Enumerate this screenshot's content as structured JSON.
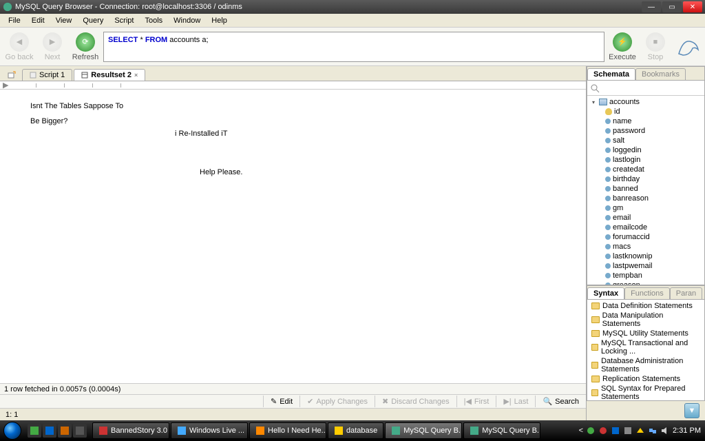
{
  "window": {
    "title": "MySQL Query Browser - Connection: root@localhost:3306 / odinms"
  },
  "menu": {
    "file": "File",
    "edit": "Edit",
    "view": "View",
    "query": "Query",
    "script": "Script",
    "tools": "Tools",
    "window": "Window",
    "help": "Help"
  },
  "toolbar": {
    "goback": "Go back",
    "next": "Next",
    "refresh": "Refresh",
    "execute": "Execute",
    "stop": "Stop"
  },
  "query": {
    "kw1": "SELECT",
    "star": " * ",
    "kw2": "FROM",
    "rest": " accounts a;"
  },
  "tabs": {
    "script1": "Script 1",
    "resultset2": "Resultset 2"
  },
  "overlay": {
    "l1": "Isnt The Tables Sappose To",
    "l2": "Be Bigger?",
    "l3": "i Re-Installed iT",
    "l4": "Help Please."
  },
  "status": {
    "fetched": "1 row fetched in 0.0057s (0.0004s)",
    "pos": "1:   1"
  },
  "editbar": {
    "edit": "Edit",
    "apply": "Apply Changes",
    "discard": "Discard Changes",
    "first": "First",
    "last": "Last",
    "search": "Search"
  },
  "schemapanel": {
    "tab_schemata": "Schemata",
    "tab_bookmarks": "Bookmarks",
    "table": "accounts",
    "cols": [
      "id",
      "name",
      "password",
      "salt",
      "loggedin",
      "lastlogin",
      "createdat",
      "birthday",
      "banned",
      "banreason",
      "gm",
      "email",
      "emailcode",
      "forumaccid",
      "macs",
      "lastknownip",
      "lastpwemail",
      "tempban",
      "greason"
    ]
  },
  "syntaxpanel": {
    "tab_syntax": "Syntax",
    "tab_functions": "Functions",
    "tab_params": "Paran",
    "items": [
      "Data Definition Statements",
      "Data Manipulation Statements",
      "MySQL Utility Statements",
      "MySQL Transactional and Locking ...",
      "Database Administration Statements",
      "Replication Statements",
      "SQL Syntax for Prepared Statements"
    ]
  },
  "taskbar": {
    "tasks": [
      {
        "label": "BannedStory 3.0"
      },
      {
        "label": "Windows Live ..."
      },
      {
        "label": "Hello I Need He..."
      },
      {
        "label": "database"
      },
      {
        "label": "MySQL Query B..."
      },
      {
        "label": "MySQL Query B..."
      }
    ],
    "time": "2:31 PM"
  }
}
